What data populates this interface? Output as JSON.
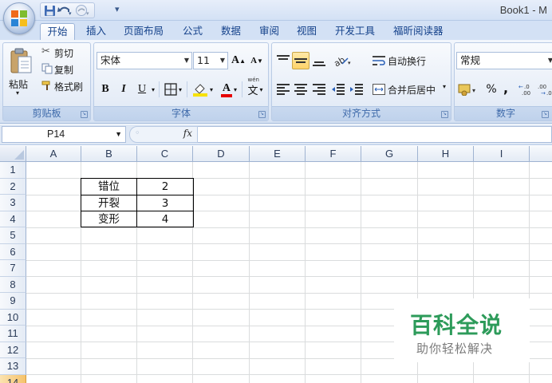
{
  "window": {
    "title": "Book1 - M"
  },
  "qat": {
    "undo_icon": "undo-icon",
    "redo_icon": "redo-icon",
    "save_icon": "save-icon"
  },
  "tabs": [
    {
      "label": "开始",
      "active": true
    },
    {
      "label": "插入"
    },
    {
      "label": "页面布局"
    },
    {
      "label": "公式"
    },
    {
      "label": "数据"
    },
    {
      "label": "审阅"
    },
    {
      "label": "视图"
    },
    {
      "label": "开发工具"
    },
    {
      "label": "福昕阅读器"
    }
  ],
  "clipboard": {
    "group_label": "剪贴板",
    "paste": "粘贴",
    "cut": "剪切",
    "copy": "复制",
    "format_painter": "格式刷"
  },
  "font": {
    "group_label": "字体",
    "font_name": "宋体",
    "font_size": "11",
    "bold": "B",
    "italic": "I",
    "underline": "U",
    "grow": "A",
    "shrink": "A",
    "font_color_letter": "A",
    "phonetic": "wén"
  },
  "alignment": {
    "group_label": "对齐方式",
    "wrap_text": "自动换行",
    "merge_center": "合并后居中"
  },
  "number": {
    "group_label": "数字",
    "format": "常规",
    "percent": "%",
    "comma": ","
  },
  "formula_bar": {
    "name_box": "P14",
    "fx": "fx",
    "value": ""
  },
  "columns": [
    "A",
    "B",
    "C",
    "D",
    "E",
    "F",
    "G",
    "H",
    "I"
  ],
  "rows": [
    "1",
    "2",
    "3",
    "4",
    "5",
    "6",
    "7",
    "8",
    "9",
    "10",
    "11",
    "12",
    "13",
    "14"
  ],
  "cells": [
    {
      "ref": "B2",
      "value": "错位"
    },
    {
      "ref": "C2",
      "value": "2"
    },
    {
      "ref": "B3",
      "value": "开裂"
    },
    {
      "ref": "C3",
      "value": "3"
    },
    {
      "ref": "B4",
      "value": "变形"
    },
    {
      "ref": "C4",
      "value": "4"
    }
  ],
  "watermark": {
    "main": "百科全说",
    "sub": "助你轻松解决"
  },
  "colors": {
    "ribbon_text": "#15428b",
    "watermark_green": "#2d9b5a"
  }
}
